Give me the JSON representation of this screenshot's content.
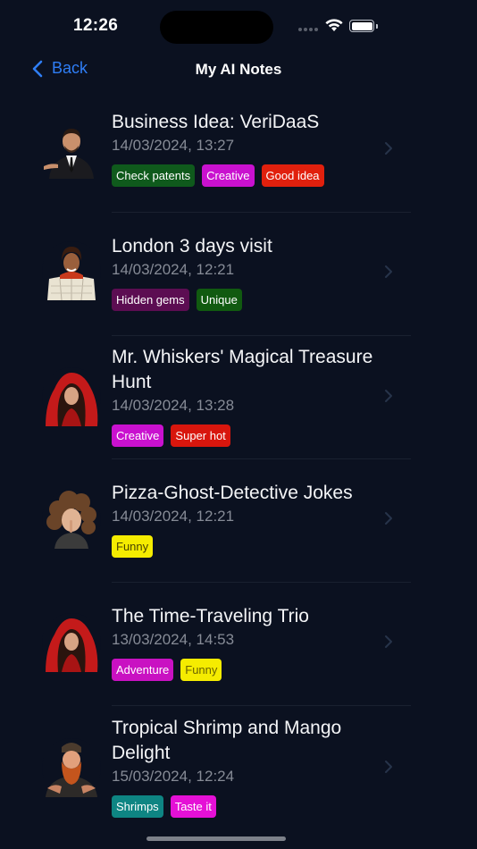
{
  "status": {
    "time": "12:26"
  },
  "nav": {
    "back_label": "Back",
    "title": "My AI Notes"
  },
  "notes": [
    {
      "title": "Business Idea: VeriDaaS",
      "date": "14/03/2024, 13:27",
      "avatar": "businessman-avatar",
      "tags": [
        {
          "label": "Check patents",
          "color": "#0f5a1c"
        },
        {
          "label": "Creative",
          "color": "#c911cf"
        },
        {
          "label": "Good idea",
          "color": "#e1200d"
        }
      ]
    },
    {
      "title": "London 3 days visit",
      "date": "14/03/2024, 12:21",
      "avatar": "traveler-with-map-avatar",
      "tags": [
        {
          "label": "Hidden gems",
          "color": "#5c0d52"
        },
        {
          "label": "Unique",
          "color": "#115a10"
        }
      ]
    },
    {
      "title": "Mr. Whiskers' Magical Treasure Hunt",
      "date": "14/03/2024, 13:28",
      "avatar": "red-hood-avatar",
      "tags": [
        {
          "label": "Creative",
          "color": "#c911cf"
        },
        {
          "label": "Super hot",
          "color": "#d8160d"
        }
      ]
    },
    {
      "title": "Pizza-Ghost-Detective Jokes",
      "date": "14/03/2024, 12:21",
      "avatar": "curly-hair-avatar",
      "tags": [
        {
          "label": "Funny",
          "color": "#f5ec00",
          "text": "#4a4500"
        }
      ]
    },
    {
      "title": "The Time-Traveling Trio",
      "date": "13/03/2024, 14:53",
      "avatar": "red-hood-avatar",
      "tags": [
        {
          "label": "Adventure",
          "color": "#c911c2"
        },
        {
          "label": "Funny",
          "color": "#f5ec00",
          "text": "#6b6400"
        }
      ]
    },
    {
      "title": "Tropical Shrimp and Mango Delight",
      "date": "15/03/2024, 12:24",
      "avatar": "bearded-chef-avatar",
      "tags": [
        {
          "label": "Shrimps",
          "color": "#0e8583"
        },
        {
          "label": "Taste it",
          "color": "#e510d6"
        }
      ]
    }
  ]
}
